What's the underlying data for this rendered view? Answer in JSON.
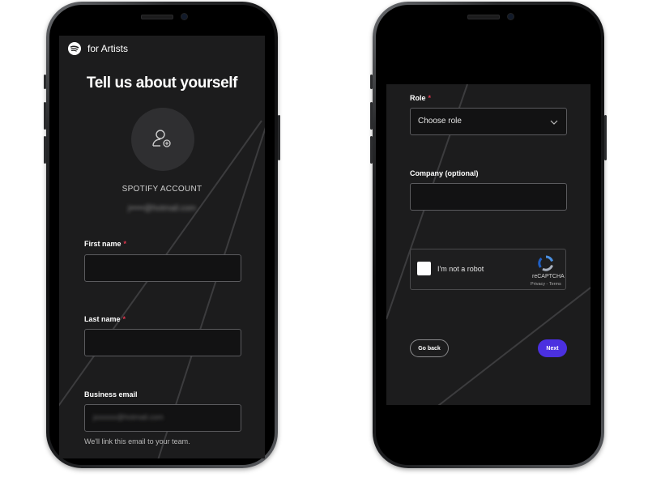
{
  "left_phone": {
    "brand": "for Artists",
    "title": "Tell us about yourself",
    "account_label": "SPOTIFY ACCOUNT",
    "account_email": "j•••••@hotmail.com",
    "fields": {
      "first_name": {
        "label": "First name",
        "required_mark": "*",
        "value": ""
      },
      "last_name": {
        "label": "Last name",
        "required_mark": "*",
        "value": ""
      },
      "business_email": {
        "label": "Business email",
        "placeholder": "jxxxxxx@hotmail.com",
        "helper": "We'll link this email to your team."
      }
    }
  },
  "right_phone": {
    "role": {
      "label": "Role",
      "required_mark": "*",
      "value": "Choose role"
    },
    "company": {
      "label": "Company (optional)",
      "value": ""
    },
    "recaptcha": {
      "label": "I'm not a robot",
      "brand": "reCAPTCHA",
      "links": "Privacy - Terms"
    },
    "buttons": {
      "back": "Go back",
      "next": "Next"
    }
  },
  "colors": {
    "accent": "#4b30e0",
    "required": "#e3364e",
    "screen_bg": "#1c1c1d"
  }
}
